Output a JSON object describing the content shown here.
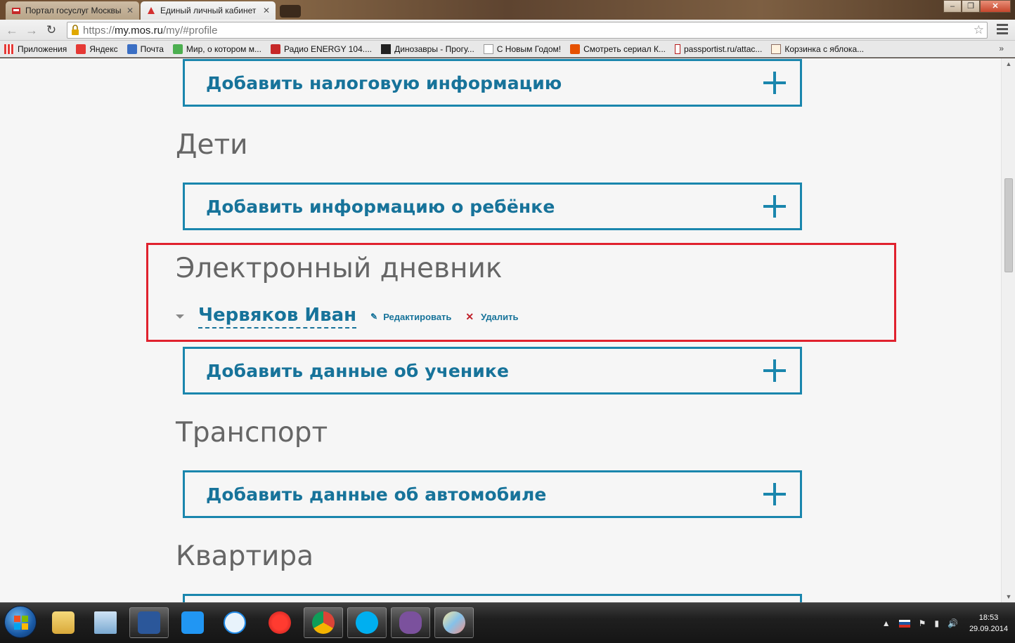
{
  "browser": {
    "tabs": [
      {
        "label": "Портал госуслуг Москвы",
        "active": false
      },
      {
        "label": "Единый личный кабинет",
        "active": true
      }
    ],
    "url": {
      "prefix": "https://",
      "host": "my.mos.ru",
      "path": "/my/#profile"
    },
    "bookmarks": [
      {
        "label": "Приложения",
        "icon": "apps-grid-icon"
      },
      {
        "label": "Яндекс",
        "icon": "yandex-icon"
      },
      {
        "label": "Почта",
        "icon": "mail-icon"
      },
      {
        "label": "Мир, о котором м...",
        "icon": "frog-icon"
      },
      {
        "label": "Радио ENERGY 104....",
        "icon": "radio-icon"
      },
      {
        "label": "Динозавры - Прогу...",
        "icon": "bbc-icon"
      },
      {
        "label": "С Новым Годом!",
        "icon": "page-icon"
      },
      {
        "label": "Смотреть сериал К...",
        "icon": "ctc-icon"
      },
      {
        "label": "passportist.ru/attac...",
        "icon": "bookmark-icon"
      },
      {
        "label": "Корзинка с яблока...",
        "icon": "home-icon"
      }
    ],
    "more": "»"
  },
  "page": {
    "tax_add": "Добавить налоговую информацию",
    "children_title": "Дети",
    "child_add": "Добавить информацию о ребёнке",
    "diary_title": "Электронный дневник",
    "student_name": "Червяков Иван",
    "edit_label": "Редактировать",
    "delete_label": "Удалить",
    "student_add": "Добавить данные об ученике",
    "transport_title": "Транспорт",
    "car_add": "Добавить данные об автомобиле",
    "apartment_title": "Квартира"
  },
  "taskbar": {
    "apps": [
      "file-explorer-icon",
      "scanner-icon",
      "word-icon",
      "zello-icon",
      "teamviewer-icon",
      "yandex-browser-icon",
      "chrome-icon",
      "skype-icon",
      "viber-icon",
      "paint-icon"
    ],
    "clock_time": "18:53",
    "clock_date": "29.09.2014"
  },
  "colors": {
    "accent": "#1a86ad",
    "accent_text": "#17739a",
    "highlight": "#e0222e",
    "heading": "#666666"
  }
}
